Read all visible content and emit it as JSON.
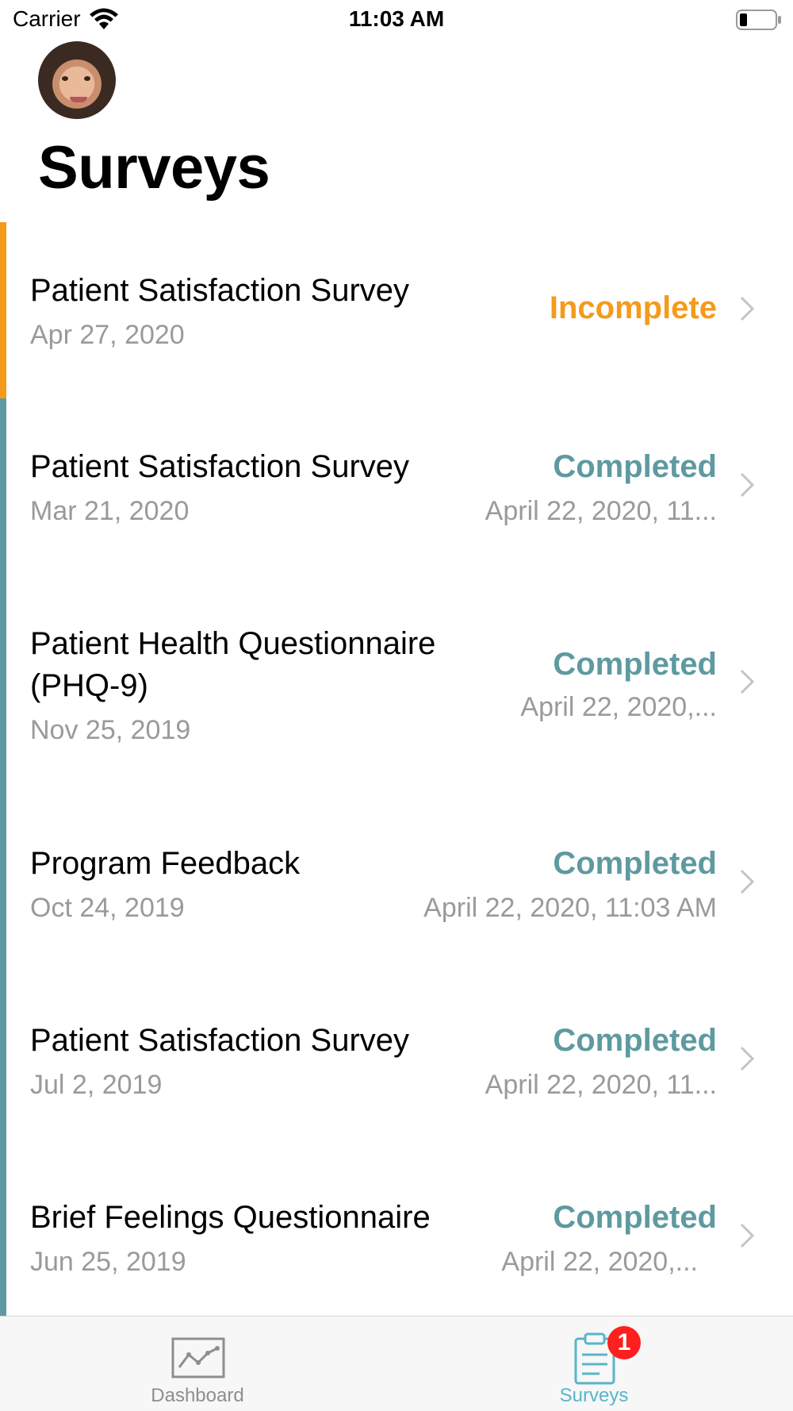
{
  "status_bar": {
    "carrier": "Carrier",
    "time": "11:03 AM"
  },
  "header": {
    "title": "Surveys"
  },
  "surveys": [
    {
      "title": "Patient Satisfaction Survey",
      "date": "Apr 27, 2020",
      "status": "Incomplete",
      "completed_at": ""
    },
    {
      "title": "Patient Satisfaction Survey",
      "date": "Mar 21, 2020",
      "status": "Completed",
      "completed_at": "April 22, 2020, 11..."
    },
    {
      "title_line1": "Patient Health Questionnaire",
      "title_line2": "(PHQ-9)",
      "date": "Nov 25, 2019",
      "status": "Completed",
      "completed_at": "April 22, 2020,..."
    },
    {
      "title": "Program Feedback",
      "date": "Oct 24, 2019",
      "status": "Completed",
      "completed_at": "April 22, 2020, 11:03 AM"
    },
    {
      "title": "Patient Satisfaction Survey",
      "date": "Jul 2, 2019",
      "status": "Completed",
      "completed_at": "April 22, 2020, 11..."
    },
    {
      "title": "Brief Feelings Questionnaire",
      "date": "Jun 25, 2019",
      "status": "Completed",
      "completed_at": "April 22, 2020,..."
    }
  ],
  "tab_bar": {
    "tabs": [
      {
        "label": "Dashboard",
        "icon": "chart-line-icon"
      },
      {
        "label": "Surveys",
        "icon": "clipboard-icon",
        "badge": "1"
      }
    ]
  },
  "colors": {
    "accent_completed": "#5e9aa0",
    "accent_incomplete": "#f59a1b",
    "tab_active": "#5ab4c8",
    "badge": "#ff1f1f"
  }
}
